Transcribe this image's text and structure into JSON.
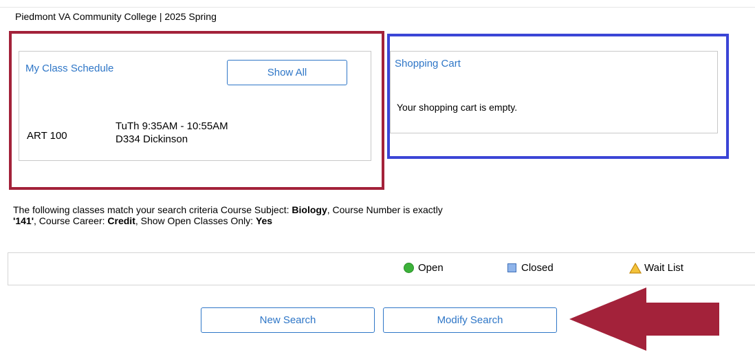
{
  "header": {
    "institution_term": "Piedmont VA Community College | 2025 Spring"
  },
  "schedule": {
    "title": "My Class Schedule",
    "show_all_label": "Show All",
    "course": {
      "code": "ART 100",
      "time": "TuTh 9:35AM - 10:55AM",
      "room": "D334 Dickinson"
    }
  },
  "cart": {
    "title": "Shopping Cart",
    "message": "Your shopping cart is empty."
  },
  "criteria": {
    "intro": "The following classes match your search criteria Course Subject: ",
    "subject": "Biology",
    "number_label": ",  Course Number is exactly",
    "number": "'141'",
    "career_label": ",  Course Career: ",
    "career": "Credit",
    "open_label": ",  Show Open Classes Only: ",
    "open": "Yes"
  },
  "legend": {
    "open": "Open",
    "closed": "Closed",
    "wait": "Wait List"
  },
  "actions": {
    "new_search": "New Search",
    "modify_search": "Modify Search"
  },
  "colors": {
    "annotation_red": "#a3223a",
    "annotation_blue": "#3b45d6",
    "link_blue": "#2e76c7"
  },
  "icons": {
    "open": "green-circle-icon",
    "closed": "blue-square-icon",
    "wait": "warning-triangle-icon",
    "arrow": "left-arrow-annotation"
  }
}
